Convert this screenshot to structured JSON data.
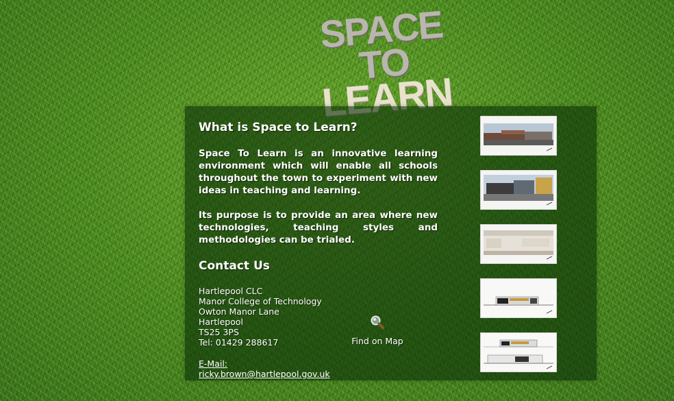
{
  "logo": {
    "line1": "SPACE TO",
    "line2": "LEARN"
  },
  "about": {
    "title": "What is Space to Learn?",
    "paragraph1": "Space To Learn is an innovative learning environment which will enable all schools throughout the town to experiment with new ideas in teaching and learning.",
    "paragraph2": "Its purpose is to provide an area where new technologies, teaching styles and methodologies can be trialed."
  },
  "contact": {
    "title": "Contact Us",
    "address": [
      "Hartlepool CLC",
      "Manor College of Technology",
      "Owton Manor Lane",
      "Hartlepool",
      "TS25 3PS",
      "Tel: 01429 288617"
    ],
    "email_label": "E-Mail:",
    "email": "ricky.brown@hartlepool.gov.uk",
    "map_label": "Find on Map",
    "map_icon": "magnifier-icon"
  },
  "thumbnails": [
    {
      "name": "building-exterior-render-1"
    },
    {
      "name": "building-exterior-render-2"
    },
    {
      "name": "interior-render"
    },
    {
      "name": "elevation-drawing-1"
    },
    {
      "name": "elevation-drawing-2"
    }
  ]
}
